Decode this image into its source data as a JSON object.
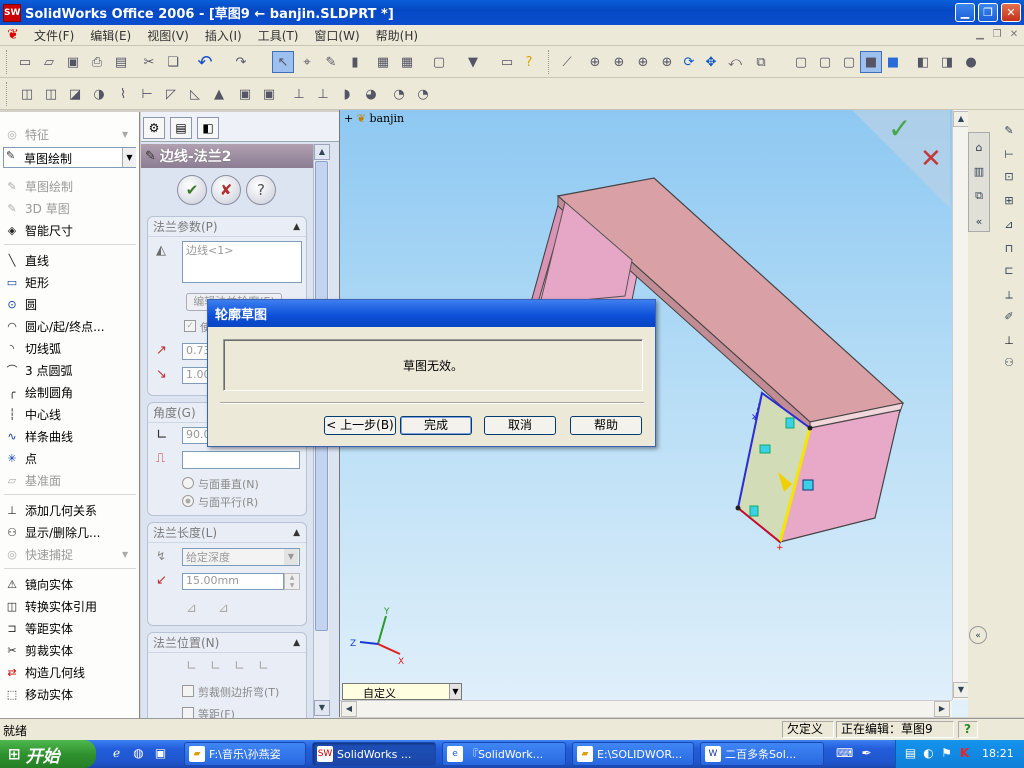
{
  "window": {
    "title": "SolidWorks Office 2006 - [草图9 ← banjin.SLDPRT *]",
    "app_icon": "SW"
  },
  "menu": [
    "文件(F)",
    "编辑(E)",
    "视图(V)",
    "插入(I)",
    "工具(T)",
    "窗口(W)",
    "帮助(H)"
  ],
  "sketch_panel": {
    "tab_features": "特征",
    "dropdown": "草图绘制",
    "items": [
      {
        "label": "草图绘制",
        "icon": "sketch-icon",
        "enabled": false
      },
      {
        "label": "3D 草图",
        "icon": "3d-sketch-icon",
        "enabled": false
      },
      {
        "label": "智能尺寸",
        "icon": "smart-dimension-icon",
        "enabled": true
      },
      {
        "label": "直线",
        "icon": "line-icon",
        "enabled": true
      },
      {
        "label": "矩形",
        "icon": "rectangle-icon",
        "enabled": true
      },
      {
        "label": "圆",
        "icon": "circle-icon",
        "enabled": true
      },
      {
        "label": "圆心/起/终点...",
        "icon": "centerpoint-arc-icon",
        "enabled": true
      },
      {
        "label": "切线弧",
        "icon": "tangent-arc-icon",
        "enabled": true
      },
      {
        "label": "3 点圆弧",
        "icon": "3-point-arc-icon",
        "enabled": true
      },
      {
        "label": "绘制圆角",
        "icon": "sketch-fillet-icon",
        "enabled": true
      },
      {
        "label": "中心线",
        "icon": "centerline-icon",
        "enabled": true
      },
      {
        "label": "样条曲线",
        "icon": "spline-icon",
        "enabled": true
      },
      {
        "label": "点",
        "icon": "point-icon",
        "enabled": true
      },
      {
        "label": "基准面",
        "icon": "plane-icon",
        "enabled": false
      },
      {
        "label": "添加几何关系",
        "icon": "add-relation-icon",
        "enabled": true
      },
      {
        "label": "显示/删除几...",
        "icon": "display-delete-relations-icon",
        "enabled": true
      },
      {
        "label": "快速捕捉",
        "icon": "quick-snaps-icon",
        "enabled": false
      },
      {
        "label": "镜向实体",
        "icon": "mirror-entities-icon",
        "enabled": true
      },
      {
        "label": "转换实体引用",
        "icon": "convert-entities-icon",
        "enabled": true
      },
      {
        "label": "等距实体",
        "icon": "offset-entities-icon",
        "enabled": true
      },
      {
        "label": "剪裁实体",
        "icon": "trim-entities-icon",
        "enabled": true
      },
      {
        "label": "构造几何线",
        "icon": "construction-geometry-icon",
        "enabled": true
      },
      {
        "label": "移动实体",
        "icon": "move-entities-icon",
        "enabled": true
      }
    ]
  },
  "property_manager": {
    "title": "边线-法兰2",
    "flange_params": {
      "header": "法兰参数(P)",
      "edge_value": "边线<1>",
      "edit_profile_button": "编辑法兰轮廓(E)",
      "use_default_radius": "使",
      "radius_value": "0.73",
      "gap_value": "1.00"
    },
    "angle": {
      "header": "角度(G)",
      "angle_value": "90.0",
      "perpendicular": "与面垂直(N)",
      "parallel": "与面平行(R)"
    },
    "flange_length": {
      "header": "法兰长度(L)",
      "end_condition": "给定深度",
      "depth_value": "15.00mm"
    },
    "flange_position": {
      "header": "法兰位置(N)",
      "trim_side_bends": "剪裁侧边折弯(T)",
      "offset": "等距(F)"
    }
  },
  "graphics": {
    "tree_label": "banjin",
    "view_dropdown": "自定义",
    "triad": {
      "x": "X",
      "y": "Y",
      "z": "Z"
    },
    "accent_pink": "#e8a9c8",
    "accent_top": "#d9a0a6"
  },
  "dialog": {
    "title": "轮廓草图",
    "message": "草图无效。",
    "buttons": {
      "back": "< 上一步(B)",
      "finish": "完成",
      "cancel": "取消",
      "help": "帮助"
    }
  },
  "status": {
    "left": "就绪",
    "units": "欠定义",
    "editing": "正在编辑：草图9",
    "help": "?"
  },
  "taskbar": {
    "start": "开始",
    "tasks": [
      {
        "label": "F:\\音乐\\孙燕姿",
        "icon": "folder-icon"
      },
      {
        "label": "SolidWorks ...",
        "icon": "solidworks-icon",
        "active": true
      },
      {
        "label": "『SolidWork...",
        "icon": "ie-icon"
      },
      {
        "label": "E:\\SOLIDWOR...",
        "icon": "folder-icon"
      },
      {
        "label": "二百多条Sol...",
        "icon": "word-icon"
      }
    ],
    "clock": "18:21"
  }
}
